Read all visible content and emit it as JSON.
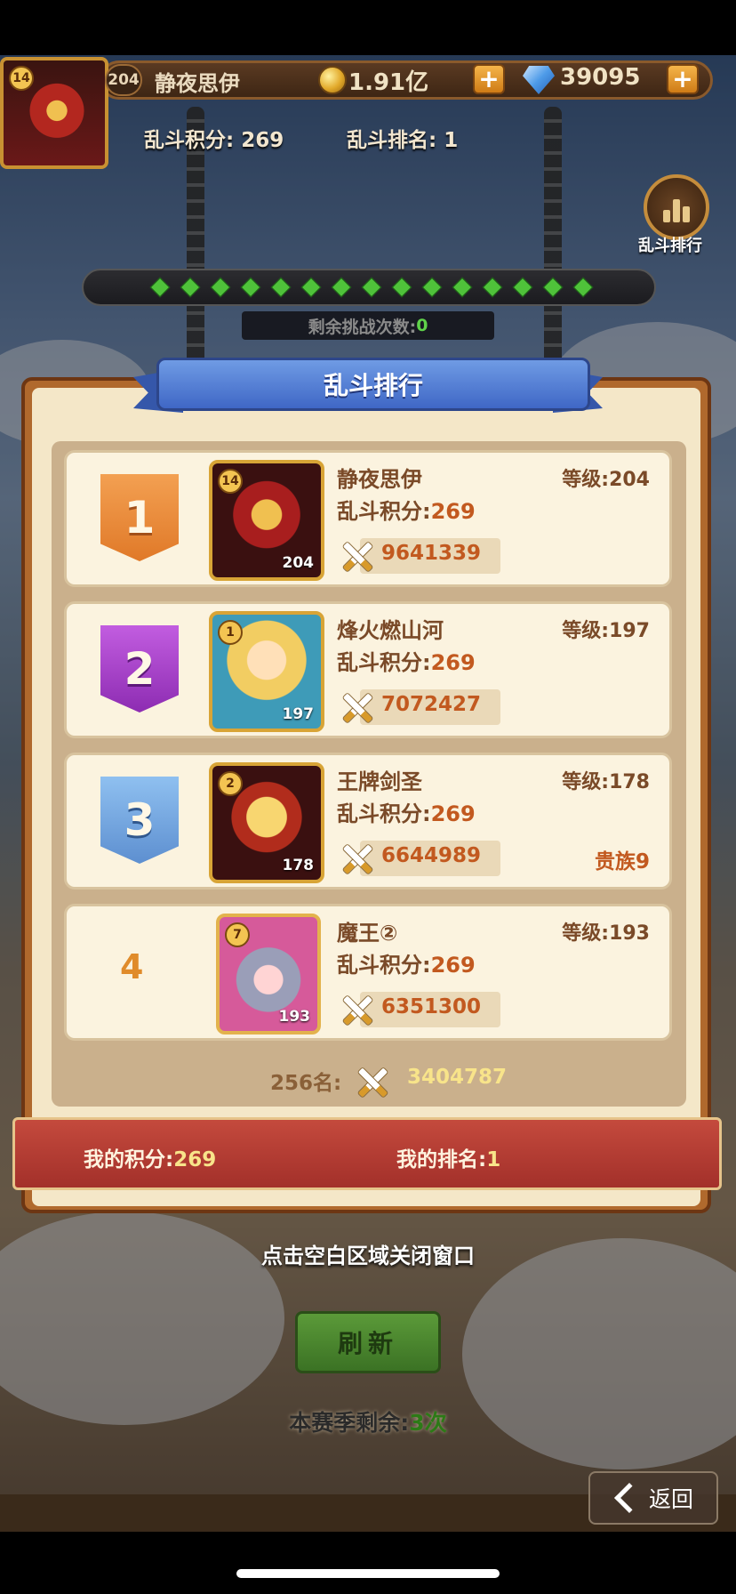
{
  "header": {
    "avatar_star": "14",
    "level": "204",
    "player_name": "静夜思伊",
    "gold": "1.91亿",
    "gems": "39095",
    "plus": "+",
    "brawl_score_label": "乱斗积分: 269",
    "brawl_rank_label": "乱斗排名: 1"
  },
  "side_button": {
    "label": "乱斗排行",
    "icon": "bar-chart-icon"
  },
  "challenges": {
    "label": "剩余挑战次数: ",
    "count": "0"
  },
  "panel": {
    "title": "乱斗排行",
    "score_label": "乱斗积分:",
    "level_label": "等级:",
    "rows": [
      {
        "rank": "1",
        "name": "静夜思伊",
        "level": "204",
        "score": "269",
        "power": "9641339",
        "star": "14",
        "avatar_level": "204",
        "title": ""
      },
      {
        "rank": "2",
        "name": "烽火燃山河",
        "level": "197",
        "score": "269",
        "power": "7072427",
        "star": "1",
        "avatar_level": "197",
        "title": ""
      },
      {
        "rank": "3",
        "name": "王牌剑圣",
        "level": "178",
        "score": "269",
        "power": "6644989",
        "star": "2",
        "avatar_level": "178",
        "title": "贵族9"
      },
      {
        "rank": "4",
        "name": "魔王②",
        "level": "193",
        "score": "269",
        "power": "6351300",
        "star": "7",
        "avatar_level": "193",
        "title": ""
      }
    ],
    "rank256_label": "256名:",
    "rank256_power": "3404787",
    "my_score_label": "我的积分:",
    "my_score": "269",
    "my_rank_label": "我的排名:",
    "my_rank": "1"
  },
  "close_hint": "点击空白区域关闭窗口",
  "refresh_label": "刷新",
  "season": {
    "label": "本赛季剩余:",
    "count": "3次"
  },
  "back_label": "返回",
  "colors": {
    "accent_orange": "#c2591f",
    "gold_text": "#f8e48a",
    "green": "#5fd24a"
  }
}
